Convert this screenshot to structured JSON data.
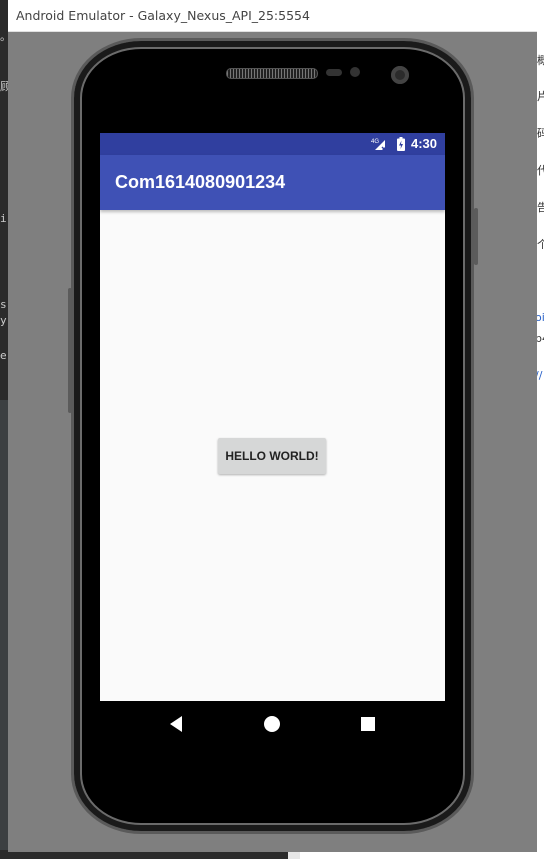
{
  "window": {
    "title": "Android Emulator - Galaxy_Nexus_API_25:5554"
  },
  "status_bar": {
    "time": "4:30",
    "network_label": "4G",
    "icons": [
      "signal-icon",
      "battery-icon"
    ]
  },
  "app_bar": {
    "title": "Com1614080901234"
  },
  "main": {
    "button_label": "HELLO WORLD!"
  },
  "nav_bar": {
    "icons": [
      "back-icon",
      "home-icon",
      "recent-apps-icon"
    ]
  },
  "background_fragments": {
    "left": [
      "。",
      "顾",
      "i",
      "s",
      "y",
      "e"
    ],
    "right": [
      "概",
      "片",
      "码",
      "代",
      "告",
      "个",
      "oi",
      "p4",
      "//"
    ]
  },
  "colors": {
    "status_bar": "#303f9f",
    "app_bar": "#3f51b5",
    "screen_background": "#fafafa",
    "button": "#d6d7d7",
    "emulator_background": "#7f7f7f"
  }
}
